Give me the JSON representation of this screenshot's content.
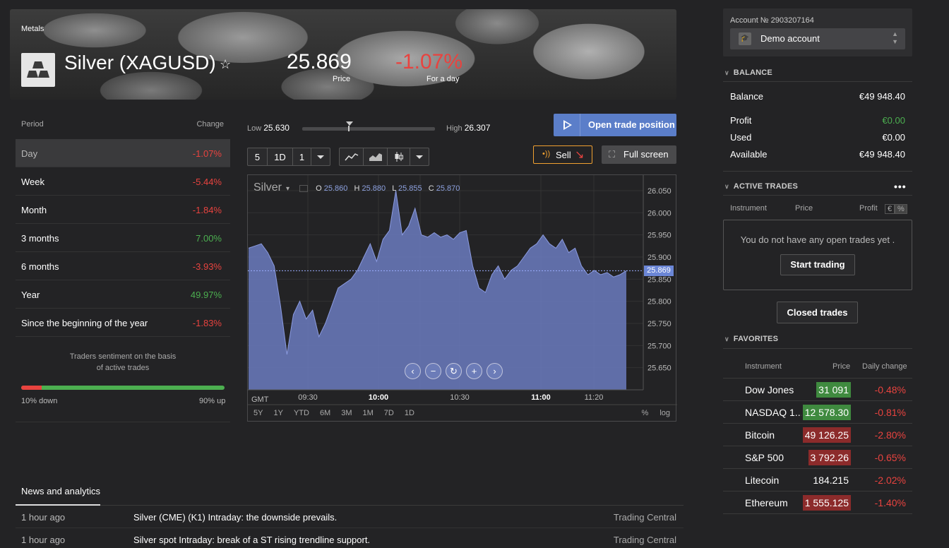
{
  "header": {
    "category": "Metals",
    "title": "Silver (XAGUSD)",
    "price": "25.869",
    "price_label": "Price",
    "change": "-1.07%",
    "change_label": "For a day"
  },
  "period_table": {
    "col_period": "Period",
    "col_change": "Change",
    "rows": [
      {
        "label": "Day",
        "value": "-1.07%"
      },
      {
        "label": "Week",
        "value": "-5.44%"
      },
      {
        "label": "Month",
        "value": "-1.84%"
      },
      {
        "label": "3 months",
        "value": "7.00%"
      },
      {
        "label": "6 months",
        "value": "-3.93%"
      },
      {
        "label": "Year",
        "value": "49.97%"
      },
      {
        "label": "Since the beginning of the year",
        "value": "-1.83%"
      }
    ]
  },
  "sentiment": {
    "line1": "Traders sentiment on the basis",
    "line2": "of active trades",
    "down_fraction": 0.1,
    "down_label": "10% down",
    "up_label": "90% up"
  },
  "range": {
    "low_label": "Low",
    "low": "25.630",
    "high_label": "High",
    "high": "26.307",
    "current_fraction": 0.35
  },
  "actions": {
    "open_trade": "Open trade position",
    "sell": "Sell",
    "fullscreen": "Full screen"
  },
  "toolbar": {
    "period_value": "5",
    "interval": "1D",
    "interval2": "1"
  },
  "chart": {
    "symbol": "Silver",
    "ohlc": {
      "o_label": "O",
      "o": "25.860",
      "h_label": "H",
      "h": "25.880",
      "l_label": "L",
      "l": "25.855",
      "c_label": "C",
      "c": "25.870"
    },
    "current_price_tag": "25.869",
    "gmt_label": "GMT",
    "range_tabs": [
      "5Y",
      "1Y",
      "YTD",
      "6M",
      "3M",
      "1M",
      "7D",
      "1D"
    ],
    "scale_pct": "%",
    "scale_log": "log"
  },
  "chart_data": {
    "type": "area",
    "series": [
      {
        "values": [
          25.92,
          25.925,
          25.93,
          25.91,
          25.88,
          25.79,
          25.68,
          25.77,
          25.8,
          25.76,
          25.78,
          25.72,
          25.75,
          25.79,
          25.83,
          25.84,
          25.85,
          25.87,
          25.9,
          25.93,
          25.89,
          25.94,
          25.96,
          26.05,
          25.95,
          25.97,
          26.01,
          25.95,
          25.945,
          25.955,
          25.945,
          25.95,
          25.94,
          25.955,
          25.96,
          25.88,
          25.83,
          25.82,
          25.86,
          25.88,
          25.85,
          25.87,
          25.88,
          25.9,
          25.92,
          25.93,
          25.95,
          25.93,
          25.92,
          25.94,
          25.91,
          25.92,
          25.88,
          25.86,
          25.87,
          25.86,
          25.865,
          25.855,
          25.86,
          25.869
        ]
      }
    ],
    "x_ticks": [
      "09:30",
      "10:00",
      "10:30",
      "11:00",
      "11:20"
    ],
    "y_ticks": [
      26.05,
      26.0,
      25.95,
      25.9,
      25.85,
      25.8,
      25.75,
      25.7,
      25.65
    ],
    "ylim": [
      25.6,
      26.085
    ],
    "grid": true
  },
  "news": {
    "title": "News and analytics",
    "items": [
      {
        "time": "1 hour ago",
        "headline": "Silver (CME) (K1) Intraday: the downside prevails.",
        "source": "Trading Central"
      },
      {
        "time": "1 hour ago",
        "headline": "Silver spot Intraday: break of a ST rising trendline support.",
        "source": "Trading Central"
      }
    ]
  },
  "account": {
    "number_label": "Account № 2903207164",
    "selected": "Demo account"
  },
  "balance": {
    "section": "BALANCE",
    "rows": [
      {
        "label": "Balance",
        "value": "€49 948.40"
      },
      {
        "label": "Profit",
        "value": "€0.00"
      },
      {
        "label": "Used",
        "value": "€0.00"
      },
      {
        "label": "Available",
        "value": "€49 948.40"
      }
    ]
  },
  "active_trades": {
    "section": "ACTIVE TRADES",
    "col_instrument": "Instrument",
    "col_price": "Price",
    "col_profit": "Profit",
    "unit_eur": "€",
    "unit_pct": "%",
    "empty_msg": "You do not have any open trades yet .",
    "start_btn": "Start trading",
    "closed_btn": "Closed trades"
  },
  "favorites": {
    "section": "FAVORITES",
    "col_instrument": "Instrument",
    "col_price": "Price",
    "col_change": "Daily change",
    "rows": [
      {
        "name": "Dow Jones",
        "price": "31 091",
        "change": "-0.48%",
        "bg": "up"
      },
      {
        "name": "NASDAQ 1...",
        "price": "12 578.30",
        "change": "-0.81%",
        "bg": "up"
      },
      {
        "name": "Bitcoin",
        "price": "49 126.25",
        "change": "-2.80%",
        "bg": "dn"
      },
      {
        "name": "S&P 500",
        "price": "3 792.26",
        "change": "-0.65%",
        "bg": "dn"
      },
      {
        "name": "Litecoin",
        "price": "184.215",
        "change": "-2.02%",
        "bg": "none"
      },
      {
        "name": "Ethereum",
        "price": "1 555.125",
        "change": "-1.40%",
        "bg": "dn"
      }
    ]
  }
}
